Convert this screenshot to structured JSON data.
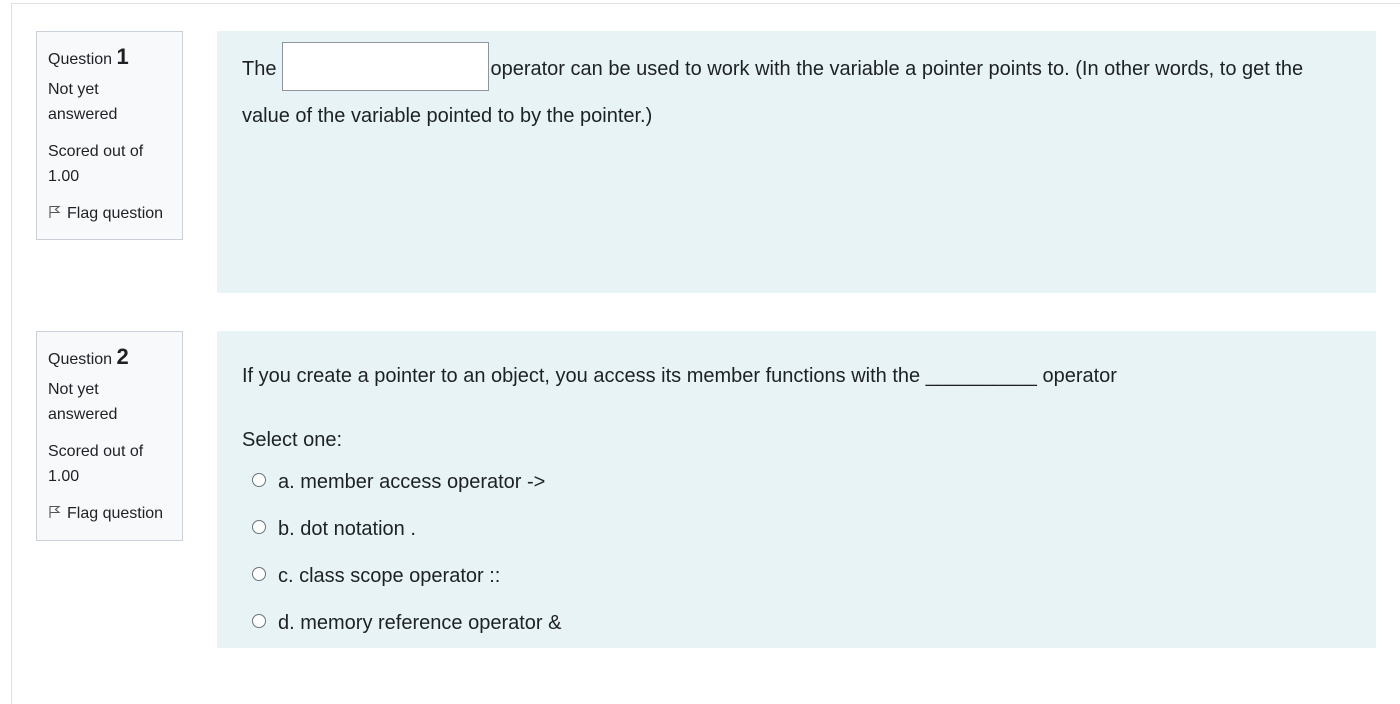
{
  "questions": [
    {
      "label": "Question",
      "number": "1",
      "state_line1": "Not yet",
      "state_line2": "answered",
      "grade_line1": "Scored out of",
      "grade_line2": "1.00",
      "flag_label": "Flag question",
      "text_before": "The",
      "text_after": "operator can be used to work with the variable a pointer points to. (In other words, to get the value of the variable pointed to by the pointer.)",
      "input_value": ""
    },
    {
      "label": "Question",
      "number": "2",
      "state_line1": "Not yet",
      "state_line2": "answered",
      "grade_line1": "Scored out of",
      "grade_line2": "1.00",
      "flag_label": "Flag question",
      "text": "If you create a pointer to an object, you access its member functions with the __________ operator",
      "prompt": "Select one:",
      "options": [
        "a. member access operator ->",
        "b. dot notation .",
        "c. class scope operator ::",
        "d. memory reference operator &"
      ]
    }
  ]
}
